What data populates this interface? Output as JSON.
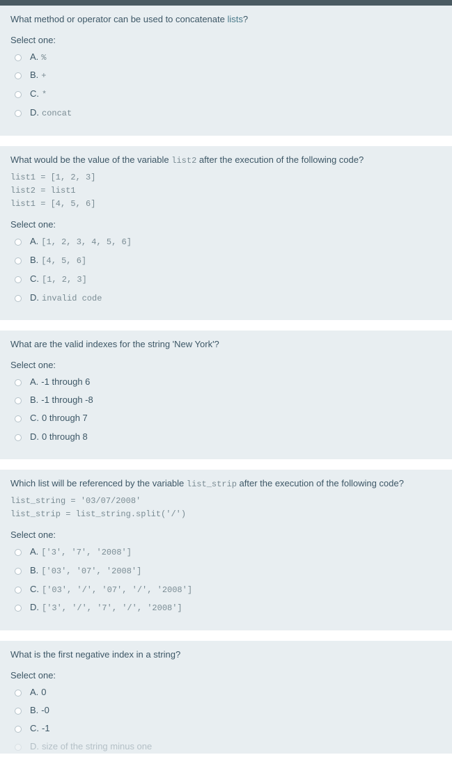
{
  "select_one": "Select one:",
  "q1": {
    "text_pre": "What method or operator can be used to concatenate ",
    "link": "lists",
    "text_post": "?",
    "a_letter": "A.",
    "a_val": "%",
    "b_letter": "B.",
    "b_val": "+",
    "c_letter": "C.",
    "c_val": "*",
    "d_letter": "D.",
    "d_val": "concat"
  },
  "q2": {
    "text_pre": "What would be the value of the variable ",
    "var": "list2",
    "text_post": " after the execution of the following code?",
    "code": "list1 = [1, 2, 3]\nlist2 = list1\nlist1 = [4, 5, 6]",
    "a_letter": "A.",
    "a_val": "[1, 2, 3, 4, 5, 6]",
    "b_letter": "B.",
    "b_val": "[4, 5, 6]",
    "c_letter": "C.",
    "c_val": "[1, 2, 3]",
    "d_letter": "D.",
    "d_val": "invalid code"
  },
  "q3": {
    "text": "What are the valid indexes for the string 'New York'?",
    "a_letter": "A.",
    "a_val": "-1 through 6",
    "b_letter": "B.",
    "b_val": "-1 through -8",
    "c_letter": "C.",
    "c_val": "0 through 7",
    "d_letter": "D.",
    "d_val": "0 through 8"
  },
  "q4": {
    "text_pre": "Which list will be referenced by the variable ",
    "var": "list_strip",
    "text_post": " after the execution of the following code?",
    "code": "list_string = '03/07/2008'\nlist_strip = list_string.split('/')",
    "a_letter": "A.",
    "a_val": "['3', '7', '2008']",
    "b_letter": "B.",
    "b_val": "['03', '07', '2008']",
    "c_letter": "C.",
    "c_val": "['03', '/', '07', '/', '2008']",
    "d_letter": "D.",
    "d_val": "['3', '/', '7', '/', '2008']"
  },
  "q5": {
    "text": "What is the first negative index in a string?",
    "a_letter": "A.",
    "a_val": "0",
    "b_letter": "B.",
    "b_val": "-0",
    "c_letter": "C.",
    "c_val": "-1",
    "d_letter": "D.",
    "d_val": "size of the string minus one"
  }
}
